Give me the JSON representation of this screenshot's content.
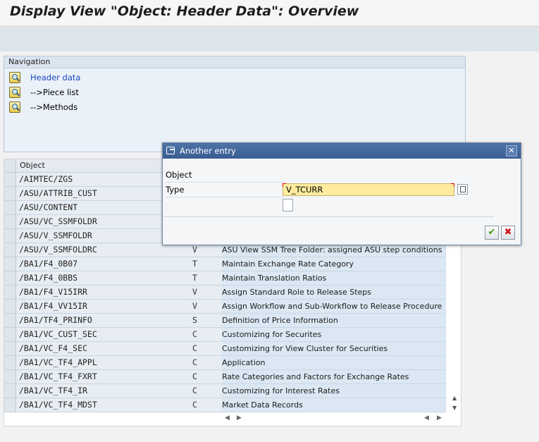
{
  "window": {
    "title": "Display View \"Object: Header Data\": Overview"
  },
  "navigation": {
    "header": "Navigation",
    "items": [
      {
        "label": "Header data",
        "active": true
      },
      {
        "label": "-->Piece list",
        "active": false
      },
      {
        "label": "-->Methods",
        "active": false
      }
    ]
  },
  "table": {
    "columns": [
      "Object",
      "",
      ""
    ],
    "rows": [
      {
        "object": "/AIMTEC/ZGS",
        "type": "",
        "desc": ""
      },
      {
        "object": "/ASU/ATTRIB_CUST",
        "type": "",
        "desc": ""
      },
      {
        "object": "/ASU/CONTENT",
        "type": "",
        "desc": ""
      },
      {
        "object": "/ASU/VC_SSMFOLDR",
        "type": "",
        "desc": ""
      },
      {
        "object": "/ASU/V_SSMFOLDR",
        "type": "",
        "desc": ""
      },
      {
        "object": "/ASU/V_SSMFOLDRC",
        "type": "V",
        "desc": "ASU View SSM Tree Folder: assigned ASU step conditions"
      },
      {
        "object": "/BA1/F4_0B07",
        "type": "T",
        "desc": "Maintain Exchange Rate Category"
      },
      {
        "object": "/BA1/F4_0BBS",
        "type": "T",
        "desc": "Maintain Translation Ratios"
      },
      {
        "object": "/BA1/F4_V15IRR",
        "type": "V",
        "desc": "Assign Standard Role to Release Steps"
      },
      {
        "object": "/BA1/F4_VV15IR",
        "type": "V",
        "desc": "Assign Workflow and Sub-Workflow to Release Procedure"
      },
      {
        "object": "/BA1/TF4_PRINFO",
        "type": "S",
        "desc": "Definition of Price Information"
      },
      {
        "object": "/BA1/VC_CUST_SEC",
        "type": "C",
        "desc": "Customizing for Securites"
      },
      {
        "object": "/BA1/VC_F4_SEC",
        "type": "C",
        "desc": "Customizing for View Cluster for Securities"
      },
      {
        "object": "/BA1/VC_TF4_APPL",
        "type": "C",
        "desc": "Application"
      },
      {
        "object": "/BA1/VC_TF4_FXRT",
        "type": "C",
        "desc": "Rate Categories and Factors for Exchange Rates"
      },
      {
        "object": "/BA1/VC_TF4_IR",
        "type": "C",
        "desc": "Customizing for Interest Rates"
      },
      {
        "object": "/BA1/VC_TF4_MDST",
        "type": "C",
        "desc": "Market Data Records"
      }
    ]
  },
  "dialog": {
    "title": "Another entry",
    "fields": [
      {
        "label": "Object",
        "value": "V_TCURR"
      },
      {
        "label": "Type",
        "value": ""
      }
    ],
    "ok_icon": "checkmark-icon",
    "cancel_icon": "cancel-x-icon"
  },
  "colors": {
    "dialog_title_bg": "#3f6398",
    "input_required_bg": "#ffec9e",
    "link": "#1d48c5"
  }
}
